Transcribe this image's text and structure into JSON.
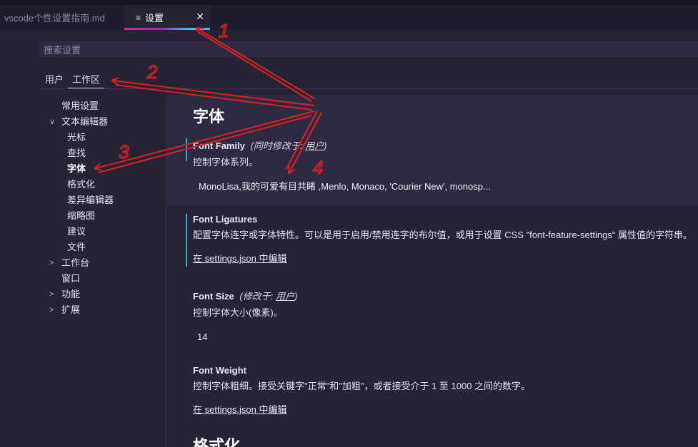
{
  "tabs": [
    {
      "label": "vscode个性设置指南.md",
      "active": false
    },
    {
      "label": "设置",
      "active": true,
      "icon": "lines-icon",
      "close_icon": "close-icon"
    }
  ],
  "search": {
    "placeholder": "搜索设置"
  },
  "scopes": [
    {
      "label": "用户",
      "active": false
    },
    {
      "label": "工作区",
      "active": true
    }
  ],
  "toc": [
    {
      "label": "常用设置",
      "level": 0,
      "chevron": ""
    },
    {
      "label": "文本编辑器",
      "level": 0,
      "chevron": "∨"
    },
    {
      "label": "光标",
      "level": 1,
      "chevron": ""
    },
    {
      "label": "查找",
      "level": 1,
      "chevron": ""
    },
    {
      "label": "字体",
      "level": 1,
      "chevron": "",
      "selected": true
    },
    {
      "label": "格式化",
      "level": 1,
      "chevron": ""
    },
    {
      "label": "差异编辑器",
      "level": 1,
      "chevron": ""
    },
    {
      "label": "缩略图",
      "level": 1,
      "chevron": ""
    },
    {
      "label": "建议",
      "level": 1,
      "chevron": ""
    },
    {
      "label": "文件",
      "level": 1,
      "chevron": ""
    },
    {
      "label": "工作台",
      "level": 0,
      "chevron": ">"
    },
    {
      "label": "窗口",
      "level": 0,
      "chevron": ""
    },
    {
      "label": "功能",
      "level": 0,
      "chevron": ">"
    },
    {
      "label": "扩展",
      "level": 0,
      "chevron": ">"
    }
  ],
  "section": {
    "title": "字体",
    "next_title": "格式化"
  },
  "settings": {
    "font_family": {
      "title": "Font Family",
      "modifier_prefix": "(同时修改于: ",
      "modifier_link": "用户",
      "modifier_suffix": ")",
      "description": "控制字体系列。",
      "value": "MonoLisa,我的可爱有目共睹 ,Menlo, Monaco, 'Courier New', monosp..."
    },
    "font_ligatures": {
      "title": "Font Ligatures",
      "description": "配置字体连字或字体特性。可以是用于启用/禁用连字的布尔值，或用于设置 CSS \"font-feature-settings\" 属性值的字符串。",
      "link": "在 settings.json 中编辑"
    },
    "font_size": {
      "title": "Font Size",
      "modifier_prefix": "(修改于: ",
      "modifier_link": "用户",
      "modifier_suffix": ")",
      "description": "控制字体大小(像素)。",
      "value": "14"
    },
    "font_weight": {
      "title": "Font Weight",
      "description": "控制字体粗细。接受关键字\"正常\"和\"加粗\"，或者接受介于 1 至 1000 之间的数字。",
      "link": "在 settings.json 中编辑"
    }
  },
  "annotations": {
    "labels": [
      "1",
      "2",
      "3",
      "4"
    ],
    "color": "#e02020"
  }
}
